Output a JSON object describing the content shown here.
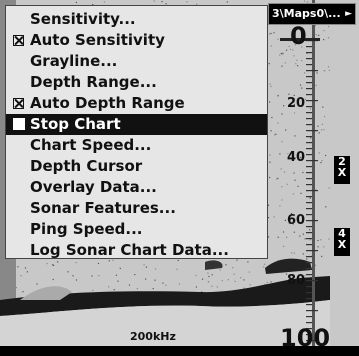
{
  "title_path": "3\\Maps0\\...",
  "path_arrow": "►",
  "depth_scale": {
    "top": "0",
    "marks": [
      "20",
      "40",
      "60",
      "80"
    ],
    "bottom": "100"
  },
  "frequency": "200kHz",
  "zoom_boxes": [
    "2\nX",
    "4\nX"
  ],
  "menu": {
    "items": [
      {
        "label": "Sensitivity...",
        "checked": false
      },
      {
        "label": "Auto Sensitivity",
        "checked": true
      },
      {
        "label": "Grayline...",
        "checked": false
      },
      {
        "label": "Depth Range...",
        "checked": false
      },
      {
        "label": "Auto Depth Range",
        "checked": true
      },
      {
        "label": "Stop Chart",
        "checked": false,
        "selected": true
      },
      {
        "label": "Chart Speed...",
        "checked": false
      },
      {
        "label": "Depth Cursor",
        "checked": false
      },
      {
        "label": "Overlay Data...",
        "checked": false
      },
      {
        "label": "Sonar Features...",
        "checked": false
      },
      {
        "label": "Ping Speed...",
        "checked": false
      },
      {
        "label": "Log Sonar Chart Data...",
        "checked": false
      }
    ]
  }
}
